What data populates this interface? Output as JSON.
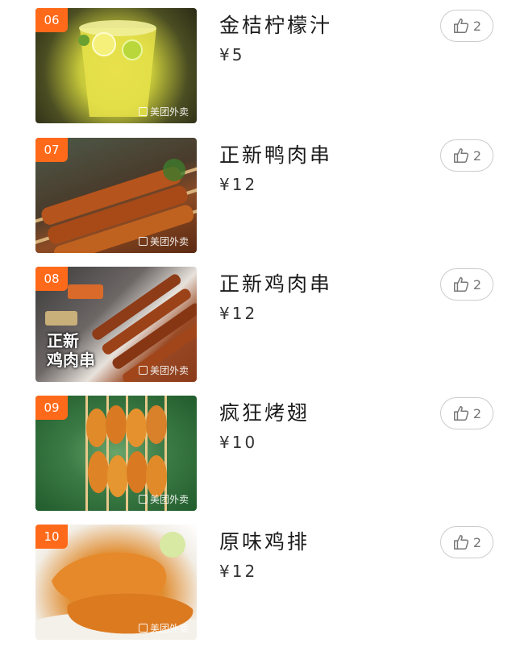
{
  "items": [
    {
      "number": "06",
      "name": "金桔柠檬汁",
      "price": "¥5",
      "likes": "2",
      "watermark": "美团外卖",
      "thumb_overlay": ""
    },
    {
      "number": "07",
      "name": "正新鸭肉串",
      "price": "¥12",
      "likes": "2",
      "watermark": "美团外卖",
      "thumb_overlay": ""
    },
    {
      "number": "08",
      "name": "正新鸡肉串",
      "price": "¥12",
      "likes": "2",
      "watermark": "美团外卖",
      "thumb_overlay": "正新\n鸡肉串"
    },
    {
      "number": "09",
      "name": "疯狂烤翅",
      "price": "¥10",
      "likes": "2",
      "watermark": "美团外卖",
      "thumb_overlay": ""
    },
    {
      "number": "10",
      "name": "原味鸡排",
      "price": "¥12",
      "likes": "2",
      "watermark": "美团外卖",
      "thumb_overlay": ""
    }
  ],
  "icons": {
    "like": "thumbs-up-icon",
    "watermark": "meituan-logo-icon"
  },
  "colors": {
    "badge": "#ff6a1a",
    "like_border": "#cccccc",
    "like_count": "#777777"
  }
}
